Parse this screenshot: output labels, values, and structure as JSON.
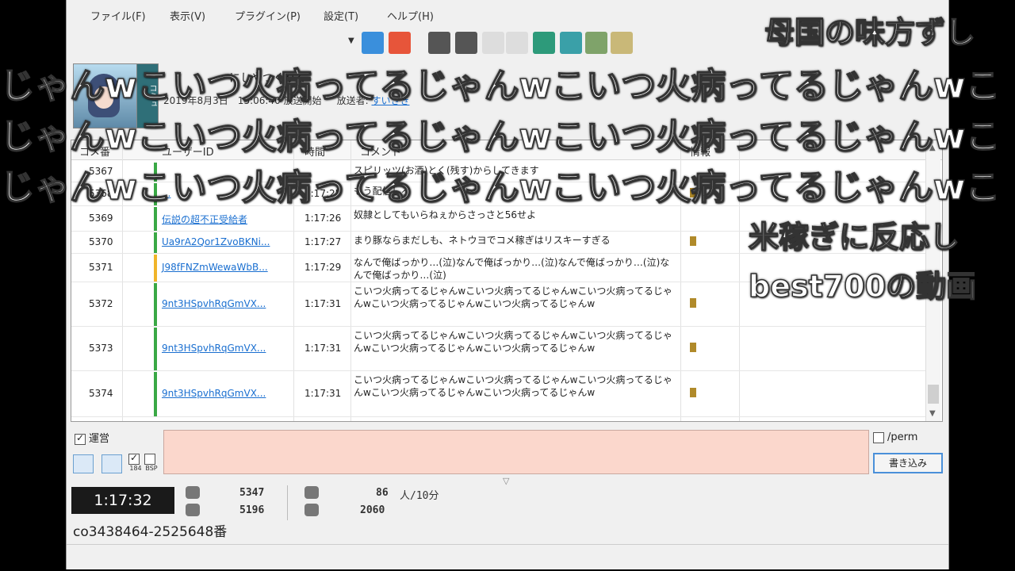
{
  "menu": [
    "ファイル(F)",
    "表示(V)",
    "プラグイン(P)",
    "設定(T)",
    "ヘルプ(H)"
  ],
  "toolbar_icons": [
    "wifi-icon",
    "record-icon",
    "camera-icon",
    "camera2-icon",
    "blank-icon",
    "blank2-icon",
    "tool-icon",
    "building-icon",
    "image-icon",
    "settings-icon"
  ],
  "broadcast": {
    "title": "にしやつくりく",
    "start": "2019年8月3日　15:06:40 放送開始",
    "broadcaster_label": "放送者:",
    "broadcaster_name": "すいきき",
    "thumb_side": "コミュ"
  },
  "table": {
    "headers": [
      "コメ番",
      "ユーザーID",
      "時間",
      "コメント",
      "情報"
    ],
    "rows": [
      {
        "num": "5367",
        "uid": "",
        "time": "",
        "comment": "スピリッツ(お酒)とく(残す)からしてきます",
        "flag": false
      },
      {
        "num": "5368",
        "uid": "...",
        "time": "1:17:25",
        "comment": "もう配信しろ",
        "flag": true
      },
      {
        "num": "5369",
        "uid": "伝説の超不正受給者",
        "time": "1:17:26",
        "comment": "奴隷としてもいらねぇからさっさと56せよ",
        "flag": false
      },
      {
        "num": "5370",
        "uid": "Ua9rA2Qor1ZvoBKNi...",
        "time": "1:17:27",
        "comment": "まり豚ならまだしも、ネトウヨでコメ稼ぎはリスキーすぎる",
        "flag": true
      },
      {
        "num": "5371",
        "uid": "J98fFNZmWewaWbB...",
        "time": "1:17:29",
        "comment": "なんで俺ばっかり…(泣)なんで俺ばっかり…(泣)なんで俺ばっかり…(泣)なんで俺ばっかり…(泣)",
        "flag": false
      },
      {
        "num": "5372",
        "uid": "9nt3HSpvhRqGmVX...",
        "time": "1:17:31",
        "comment": "こいつ火病ってるじゃんwこいつ火病ってるじゃんwこいつ火病ってるじゃんwこいつ火病ってるじゃんwこいつ火病ってるじゃんw",
        "flag": true
      },
      {
        "num": "5373",
        "uid": "9nt3HSpvhRqGmVX...",
        "time": "1:17:31",
        "comment": "こいつ火病ってるじゃんwこいつ火病ってるじゃんwこいつ火病ってるじゃんwこいつ火病ってるじゃんwこいつ火病ってるじゃんw",
        "flag": true
      },
      {
        "num": "5374",
        "uid": "9nt3HSpvhRqGmVX...",
        "time": "1:17:31",
        "comment": "こいつ火病ってるじゃんwこいつ火病ってるじゃんwこいつ火病ってるじゃんwこいつ火病ってるじゃんwこいつ火病ってるじゃんw",
        "flag": true
      }
    ]
  },
  "composer": {
    "unei_label": "運営",
    "perm_label": "/perm",
    "submit_label": "書き込み",
    "small_labels": [
      "184",
      "BSP"
    ]
  },
  "status": {
    "elapsed": "1:17:32",
    "comments": "5347",
    "visitors": "5196",
    "active": "86",
    "active_unit": "人/10分",
    "total": "2060",
    "community": "co3438464-2525648番"
  },
  "overlay": {
    "top_right": "母国の味方ずし",
    "line": "じゃんwこいつ火病ってるじゃんwこいつ火病ってるじゃんwこ",
    "right1": "米稼ぎに反応し",
    "right2": "best700の動画"
  }
}
